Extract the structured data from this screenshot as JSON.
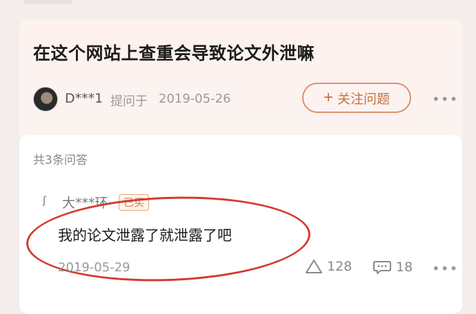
{
  "question": {
    "title": "在这个网站上查重会导致论文外泄嘛",
    "asker_name": "D***1",
    "asked_label": "提问于",
    "asked_date": "2019-05-26",
    "follow_button": "关注问题",
    "follow_icon": "+"
  },
  "answers": {
    "count_label": "共3条问答",
    "items": [
      {
        "author": "大***环",
        "badge": "已买",
        "text": "我的论文泄露了就泄露了吧",
        "date": "2019-05-29",
        "likes": "128",
        "comments": "18"
      }
    ]
  },
  "icons": {
    "more": "more-icon",
    "like": "triangle-up-icon",
    "comment": "comment-bubble-icon"
  },
  "colors": {
    "accent": "#c8703f",
    "annotation_circle": "#d43a2e",
    "card_bg": "#fdf2ee"
  }
}
